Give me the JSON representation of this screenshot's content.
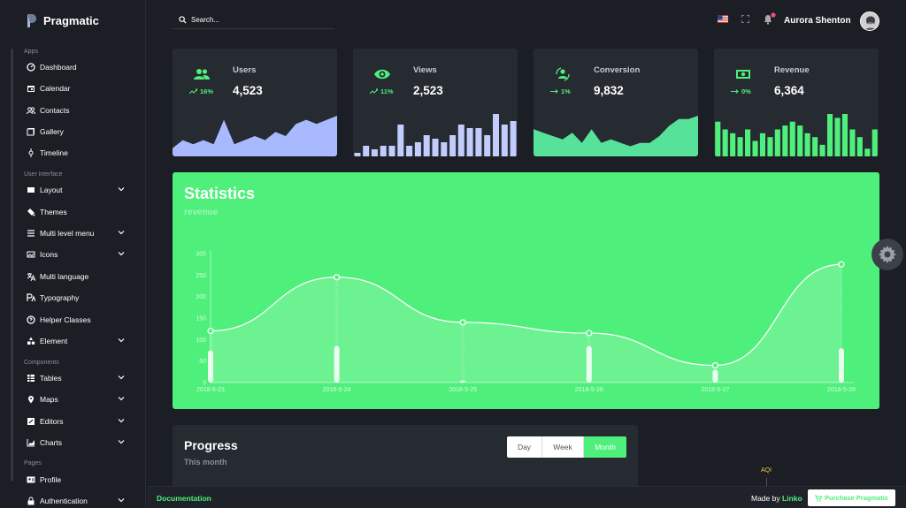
{
  "brand": {
    "name": "Pragmatic"
  },
  "sidebar": {
    "sections": {
      "apps": "Apps",
      "ui": "User interface",
      "components": "Components",
      "pages": "Pages"
    },
    "items": [
      {
        "label": "Dashboard",
        "icon": "dashboard-icon",
        "has_chevron": false
      },
      {
        "label": "Calendar",
        "icon": "calendar-icon",
        "has_chevron": false
      },
      {
        "label": "Contacts",
        "icon": "contacts-icon",
        "has_chevron": false
      },
      {
        "label": "Gallery",
        "icon": "gallery-icon",
        "has_chevron": false
      },
      {
        "label": "Timeline",
        "icon": "timeline-icon",
        "has_chevron": false
      },
      {
        "label": "Layout",
        "icon": "layout-icon",
        "has_chevron": true
      },
      {
        "label": "Themes",
        "icon": "themes-icon",
        "has_chevron": false
      },
      {
        "label": "Multi level menu",
        "icon": "menu-icon",
        "has_chevron": true
      },
      {
        "label": "Icons",
        "icon": "icons-icon",
        "has_chevron": true
      },
      {
        "label": "Multi language",
        "icon": "translate-icon",
        "has_chevron": false
      },
      {
        "label": "Typography",
        "icon": "typography-icon",
        "has_chevron": false
      },
      {
        "label": "Helper Classes",
        "icon": "help-icon",
        "has_chevron": false
      },
      {
        "label": "Element",
        "icon": "element-icon",
        "has_chevron": true
      },
      {
        "label": "Tables",
        "icon": "tables-icon",
        "has_chevron": true
      },
      {
        "label": "Maps",
        "icon": "maps-icon",
        "has_chevron": true
      },
      {
        "label": "Editors",
        "icon": "editors-icon",
        "has_chevron": true
      },
      {
        "label": "Charts",
        "icon": "charts-icon",
        "has_chevron": true
      },
      {
        "label": "Profile",
        "icon": "profile-icon",
        "has_chevron": false
      },
      {
        "label": "Authentication",
        "icon": "lock-icon",
        "has_chevron": true
      }
    ]
  },
  "topbar": {
    "search_placeholder": "Search...",
    "user_name": "Aurora Shenton",
    "has_notification": true
  },
  "cards": [
    {
      "title": "Users",
      "value": "4,523",
      "trend": "16%",
      "trend_icon": "trending-up",
      "icon": "users-icon",
      "color": "#a8b9ff",
      "spark_type": "area",
      "spark": [
        2,
        4,
        3,
        4,
        3,
        9,
        3,
        4,
        5,
        4,
        6,
        5,
        8,
        9,
        8,
        9,
        10
      ]
    },
    {
      "title": "Views",
      "value": "2,523",
      "trend": "11%",
      "trend_icon": "trending-up",
      "icon": "eye-icon",
      "color": "#c3cdfd",
      "spark_type": "bar",
      "spark": [
        1,
        3,
        2,
        3,
        3,
        9,
        3,
        4,
        6,
        5,
        4,
        6,
        9,
        8,
        8,
        6,
        12,
        9,
        10
      ]
    },
    {
      "title": "Conversion",
      "value": "9,832",
      "trend": "1%",
      "trend_icon": "arrow-right",
      "icon": "conversion-icon",
      "color": "#57e29a",
      "spark_type": "area",
      "spark": [
        8,
        7,
        6,
        5,
        7,
        4,
        8,
        4,
        5,
        4,
        3,
        4,
        4,
        6,
        9,
        11,
        11,
        12
      ]
    },
    {
      "title": "Revenue",
      "value": "6,364",
      "trend": "0%",
      "trend_icon": "arrow-right",
      "icon": "money-icon",
      "color": "#4ef07b",
      "spark_type": "bar",
      "spark": [
        9,
        7,
        6,
        5,
        7,
        4,
        6,
        5,
        7,
        8,
        9,
        8,
        6,
        5,
        3,
        11,
        10,
        11,
        7,
        5,
        2,
        7
      ]
    }
  ],
  "stats": {
    "title": "Statistics",
    "subtitle": "revenue",
    "accent": "#4ef07b",
    "chart_data": {
      "type": "line",
      "x": [
        "2018-5-23",
        "2018-5-24",
        "2018-5-25",
        "2018-5-26",
        "2018-5-27",
        "2018-5-28"
      ],
      "ylim": [
        0,
        300
      ],
      "yticks": [
        0,
        50,
        100,
        150,
        200,
        250,
        300
      ],
      "series": [
        {
          "values": [
            120,
            245,
            140,
            115,
            40,
            275
          ]
        },
        {
          "values": [
            75,
            85,
            5,
            85,
            30,
            80
          ]
        }
      ]
    }
  },
  "progress": {
    "title": "Progress",
    "subtitle": "This month",
    "tabs": [
      "Day",
      "Week",
      "Month"
    ],
    "active": "Month"
  },
  "aqi": {
    "label": "AQI"
  },
  "footer": {
    "doc": "Documentation",
    "made_by": "Made by",
    "author": "Linko",
    "purchase": "Purchase Pragmatic"
  }
}
